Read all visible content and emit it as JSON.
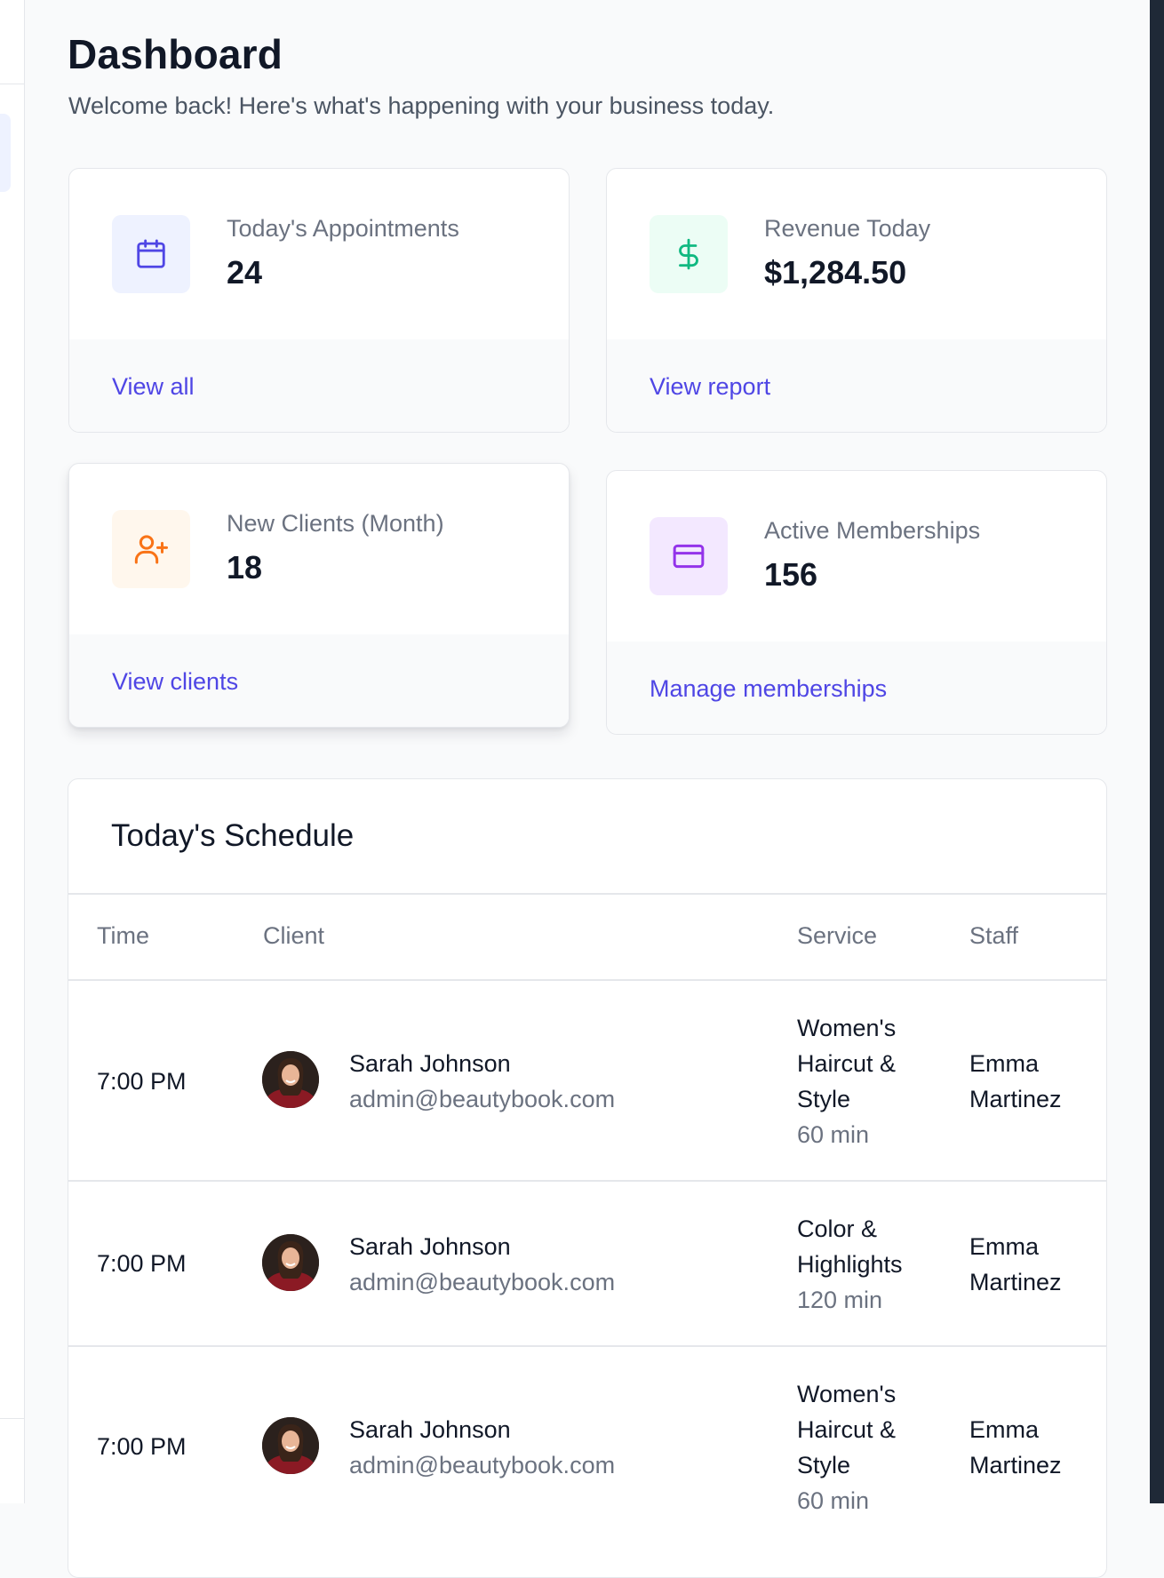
{
  "header": {
    "title": "Dashboard",
    "subtitle": "Welcome back! Here's what's happening with your business today."
  },
  "stats": [
    {
      "label": "Today's Appointments",
      "value": "24",
      "link": "View all",
      "icon": "calendar-icon",
      "icon_color": "#4f46e5",
      "icon_bg": "#eef2ff"
    },
    {
      "label": "Revenue Today",
      "value": "$1,284.50",
      "link": "View report",
      "icon": "dollar-icon",
      "icon_color": "#10b981",
      "icon_bg": "#ecfdf5"
    },
    {
      "label": "New Clients (Month)",
      "value": "18",
      "link": "View clients",
      "icon": "user-plus-icon",
      "icon_color": "#f97316",
      "icon_bg": "#fff7ed"
    },
    {
      "label": "Active Memberships",
      "value": "156",
      "link": "Manage memberships",
      "icon": "credit-card-icon",
      "icon_color": "#9333ea",
      "icon_bg": "#f3e8ff"
    }
  ],
  "schedule": {
    "title": "Today's Schedule",
    "columns": [
      "Time",
      "Client",
      "Service",
      "Staff"
    ],
    "rows": [
      {
        "time": "7:00 PM",
        "client_name": "Sarah Johnson",
        "client_email": "admin@beautybook.com",
        "service": [
          "Women's",
          "Haircut &",
          "Style"
        ],
        "duration": "60 min",
        "staff": [
          "Emma",
          "Martinez"
        ]
      },
      {
        "time": "7:00 PM",
        "client_name": "Sarah Johnson",
        "client_email": "admin@beautybook.com",
        "service": [
          "Color &",
          "Highlights"
        ],
        "duration": "120 min",
        "staff": [
          "Emma",
          "Martinez"
        ]
      },
      {
        "time": "7:00 PM",
        "client_name": "Sarah Johnson",
        "client_email": "admin@beautybook.com",
        "service": [
          "Women's",
          "Haircut &",
          "Style"
        ],
        "duration": "60 min",
        "staff": [
          "Emma",
          "Martinez"
        ]
      }
    ]
  }
}
